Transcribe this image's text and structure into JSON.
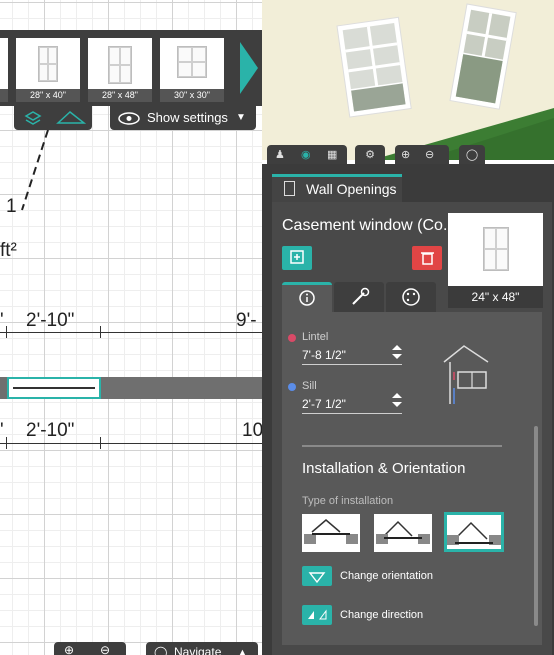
{
  "catalog": {
    "items": [
      {
        "label": ""
      },
      {
        "label": "28\" x 40\""
      },
      {
        "label": "28\" x 48\""
      },
      {
        "label": "30\" x 30\""
      }
    ]
  },
  "plan_toolbar": {
    "show_settings": "Show settings"
  },
  "plan": {
    "room_number": "1",
    "area_unit": "ft²",
    "dims_top": [
      "'",
      "2'-10\"",
      "9'-"
    ],
    "dims_bottom": [
      "'",
      "2'-10\"",
      "10"
    ]
  },
  "bottom_bar": {
    "navigate": "Navigate"
  },
  "panel": {
    "tab_label": "Wall Openings",
    "item_name": "Casement window (Co...",
    "preview_label": "24\" x 48\"",
    "fields": {
      "lintel": {
        "label": "Lintel",
        "value": "7'-8 1/2\""
      },
      "sill": {
        "label": "Sill",
        "value": "2'-7 1/2\""
      }
    },
    "installation": {
      "title": "Installation & Orientation",
      "type_label": "Type of installation",
      "change_orientation": "Change orientation",
      "change_direction": "Change direction"
    }
  },
  "colors": {
    "accent": "#2ab3a9",
    "delete": "#e14545",
    "lintel_dot": "#d94a67",
    "sill_dot": "#5b8de8"
  }
}
